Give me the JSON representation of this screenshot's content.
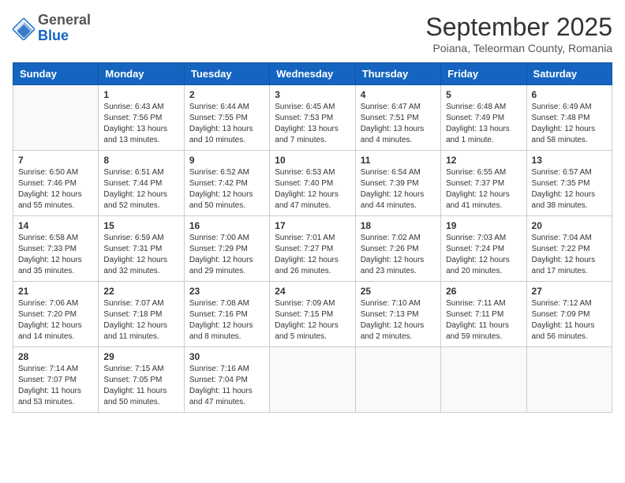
{
  "header": {
    "logo": {
      "general": "General",
      "blue": "Blue"
    },
    "title": "September 2025",
    "subtitle": "Poiana, Teleorman County, Romania"
  },
  "weekdays": [
    "Sunday",
    "Monday",
    "Tuesday",
    "Wednesday",
    "Thursday",
    "Friday",
    "Saturday"
  ],
  "weeks": [
    [
      {
        "day": "",
        "info": ""
      },
      {
        "day": "1",
        "info": "Sunrise: 6:43 AM\nSunset: 7:56 PM\nDaylight: 13 hours\nand 13 minutes."
      },
      {
        "day": "2",
        "info": "Sunrise: 6:44 AM\nSunset: 7:55 PM\nDaylight: 13 hours\nand 10 minutes."
      },
      {
        "day": "3",
        "info": "Sunrise: 6:45 AM\nSunset: 7:53 PM\nDaylight: 13 hours\nand 7 minutes."
      },
      {
        "day": "4",
        "info": "Sunrise: 6:47 AM\nSunset: 7:51 PM\nDaylight: 13 hours\nand 4 minutes."
      },
      {
        "day": "5",
        "info": "Sunrise: 6:48 AM\nSunset: 7:49 PM\nDaylight: 13 hours\nand 1 minute."
      },
      {
        "day": "6",
        "info": "Sunrise: 6:49 AM\nSunset: 7:48 PM\nDaylight: 12 hours\nand 58 minutes."
      }
    ],
    [
      {
        "day": "7",
        "info": "Sunrise: 6:50 AM\nSunset: 7:46 PM\nDaylight: 12 hours\nand 55 minutes."
      },
      {
        "day": "8",
        "info": "Sunrise: 6:51 AM\nSunset: 7:44 PM\nDaylight: 12 hours\nand 52 minutes."
      },
      {
        "day": "9",
        "info": "Sunrise: 6:52 AM\nSunset: 7:42 PM\nDaylight: 12 hours\nand 50 minutes."
      },
      {
        "day": "10",
        "info": "Sunrise: 6:53 AM\nSunset: 7:40 PM\nDaylight: 12 hours\nand 47 minutes."
      },
      {
        "day": "11",
        "info": "Sunrise: 6:54 AM\nSunset: 7:39 PM\nDaylight: 12 hours\nand 44 minutes."
      },
      {
        "day": "12",
        "info": "Sunrise: 6:55 AM\nSunset: 7:37 PM\nDaylight: 12 hours\nand 41 minutes."
      },
      {
        "day": "13",
        "info": "Sunrise: 6:57 AM\nSunset: 7:35 PM\nDaylight: 12 hours\nand 38 minutes."
      }
    ],
    [
      {
        "day": "14",
        "info": "Sunrise: 6:58 AM\nSunset: 7:33 PM\nDaylight: 12 hours\nand 35 minutes."
      },
      {
        "day": "15",
        "info": "Sunrise: 6:59 AM\nSunset: 7:31 PM\nDaylight: 12 hours\nand 32 minutes."
      },
      {
        "day": "16",
        "info": "Sunrise: 7:00 AM\nSunset: 7:29 PM\nDaylight: 12 hours\nand 29 minutes."
      },
      {
        "day": "17",
        "info": "Sunrise: 7:01 AM\nSunset: 7:27 PM\nDaylight: 12 hours\nand 26 minutes."
      },
      {
        "day": "18",
        "info": "Sunrise: 7:02 AM\nSunset: 7:26 PM\nDaylight: 12 hours\nand 23 minutes."
      },
      {
        "day": "19",
        "info": "Sunrise: 7:03 AM\nSunset: 7:24 PM\nDaylight: 12 hours\nand 20 minutes."
      },
      {
        "day": "20",
        "info": "Sunrise: 7:04 AM\nSunset: 7:22 PM\nDaylight: 12 hours\nand 17 minutes."
      }
    ],
    [
      {
        "day": "21",
        "info": "Sunrise: 7:06 AM\nSunset: 7:20 PM\nDaylight: 12 hours\nand 14 minutes."
      },
      {
        "day": "22",
        "info": "Sunrise: 7:07 AM\nSunset: 7:18 PM\nDaylight: 12 hours\nand 11 minutes."
      },
      {
        "day": "23",
        "info": "Sunrise: 7:08 AM\nSunset: 7:16 PM\nDaylight: 12 hours\nand 8 minutes."
      },
      {
        "day": "24",
        "info": "Sunrise: 7:09 AM\nSunset: 7:15 PM\nDaylight: 12 hours\nand 5 minutes."
      },
      {
        "day": "25",
        "info": "Sunrise: 7:10 AM\nSunset: 7:13 PM\nDaylight: 12 hours\nand 2 minutes."
      },
      {
        "day": "26",
        "info": "Sunrise: 7:11 AM\nSunset: 7:11 PM\nDaylight: 11 hours\nand 59 minutes."
      },
      {
        "day": "27",
        "info": "Sunrise: 7:12 AM\nSunset: 7:09 PM\nDaylight: 11 hours\nand 56 minutes."
      }
    ],
    [
      {
        "day": "28",
        "info": "Sunrise: 7:14 AM\nSunset: 7:07 PM\nDaylight: 11 hours\nand 53 minutes."
      },
      {
        "day": "29",
        "info": "Sunrise: 7:15 AM\nSunset: 7:05 PM\nDaylight: 11 hours\nand 50 minutes."
      },
      {
        "day": "30",
        "info": "Sunrise: 7:16 AM\nSunset: 7:04 PM\nDaylight: 11 hours\nand 47 minutes."
      },
      {
        "day": "",
        "info": ""
      },
      {
        "day": "",
        "info": ""
      },
      {
        "day": "",
        "info": ""
      },
      {
        "day": "",
        "info": ""
      }
    ]
  ]
}
